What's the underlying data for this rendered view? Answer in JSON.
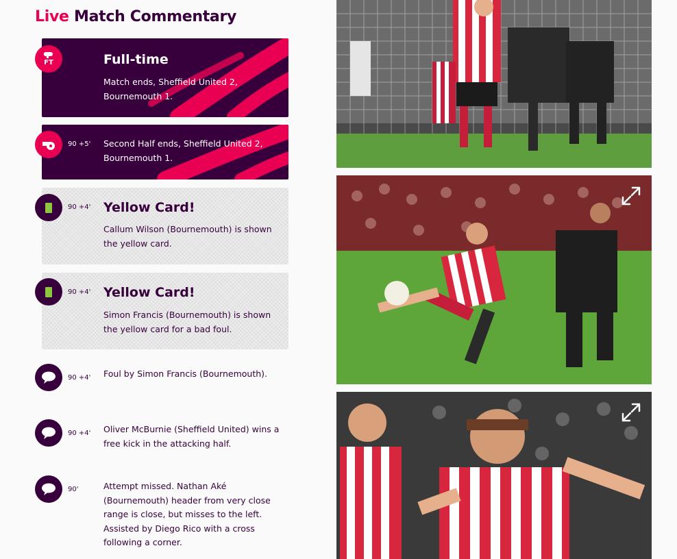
{
  "header": {
    "live_word": "Live",
    "rest": " Match Commentary"
  },
  "colors": {
    "purple": "#37003c",
    "pink": "#e90052",
    "yellow_card": "#8dc63f"
  },
  "entries": [
    {
      "type": "full-time",
      "badge": "FT",
      "minute": "",
      "title": "Full-time",
      "text": "Match ends, Sheffield United 2, Bournemouth 1."
    },
    {
      "type": "whistle",
      "minute": "90 +5'",
      "title": "",
      "text": "Second Half ends, Sheffield United 2, Bournemouth 1."
    },
    {
      "type": "yellow-card",
      "minute": "90 +4'",
      "title": "Yellow Card!",
      "text": "Callum Wilson (Bournemouth) is shown the yellow card."
    },
    {
      "type": "yellow-card",
      "minute": "90 +4'",
      "title": "Yellow Card!",
      "text": "Simon Francis (Bournemouth) is shown the yellow card for a bad foul."
    },
    {
      "type": "comment",
      "minute": "90 +4'",
      "title": "",
      "text": "Foul by Simon Francis (Bournemouth)."
    },
    {
      "type": "comment",
      "minute": "90 +4'",
      "title": "",
      "text": "Oliver McBurnie (Sheffield United) wins a free kick in the attacking half."
    },
    {
      "type": "comment",
      "minute": "90'",
      "title": "",
      "text": "Attempt missed. Nathan Aké (Bournemouth) header from very close range is close, but misses to the left. Assisted by Diego Rico with a cross following a corner."
    }
  ],
  "photos": [
    {
      "icon": "expand-icon",
      "shows_expand": false
    },
    {
      "icon": "expand-icon",
      "shows_expand": true
    },
    {
      "icon": "expand-icon",
      "shows_expand": true
    }
  ]
}
